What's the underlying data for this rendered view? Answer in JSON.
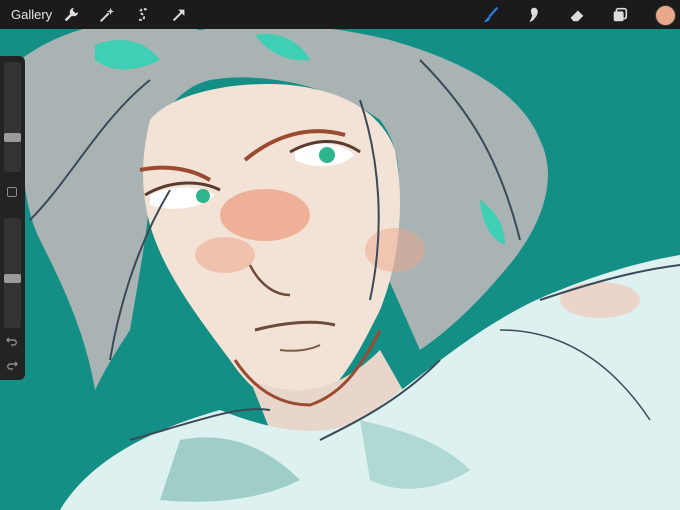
{
  "topbar": {
    "gallery_label": "Gallery",
    "left_tools": [
      "wrench-icon",
      "magic-wand-icon",
      "selection-s-icon",
      "arrow-transform-icon"
    ],
    "right_tools": [
      "brush-icon",
      "smudge-icon",
      "eraser-icon",
      "layers-icon"
    ],
    "active_tool": "brush-icon",
    "active_color": "#e9a98a"
  },
  "sidebar": {
    "brush_size_level": 0.3,
    "opacity_level": 0.45,
    "icons": [
      "modify-square-icon",
      "undo-icon",
      "redo-icon"
    ]
  },
  "canvas": {
    "background_color": "#138f85"
  }
}
